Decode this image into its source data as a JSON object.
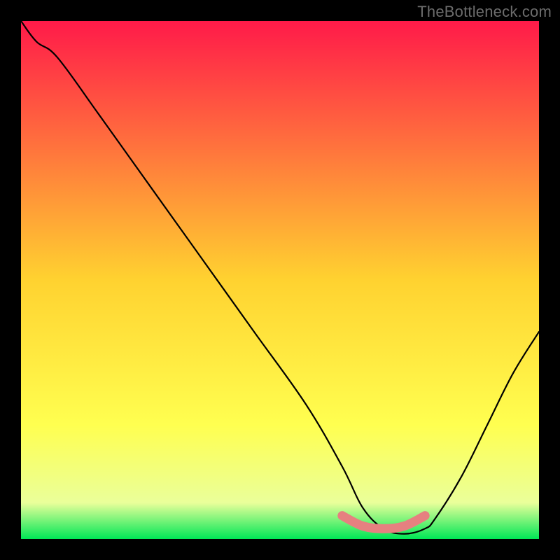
{
  "watermark": "TheBottleneck.com",
  "colors": {
    "gradient_top": "#ff1a49",
    "gradient_mid_upper": "#ff6a3e",
    "gradient_mid": "#ffd230",
    "gradient_mid_lower": "#ffff50",
    "gradient_lower": "#eaff9a",
    "gradient_bottom": "#00e756",
    "curve": "#000000",
    "bottom_arc": "#e68080",
    "frame_bg": "#000000"
  },
  "chart_data": {
    "type": "line",
    "title": "",
    "xlabel": "",
    "ylabel": "",
    "xlim": [
      0,
      100
    ],
    "ylim": [
      0,
      100
    ],
    "series": [
      {
        "name": "bottleneck-curve",
        "x": [
          0,
          3,
          7,
          15,
          25,
          35,
          45,
          55,
          62,
          66,
          70,
          74,
          78,
          80,
          85,
          90,
          95,
          100
        ],
        "y": [
          100,
          96,
          93,
          82,
          68,
          54,
          40,
          26,
          14,
          6,
          2,
          1,
          2,
          4,
          12,
          22,
          32,
          40
        ]
      },
      {
        "name": "optimal-band",
        "x": [
          62,
          66,
          70,
          74,
          78
        ],
        "y": [
          4.5,
          2.5,
          2.0,
          2.5,
          4.5
        ]
      }
    ],
    "annotations": []
  }
}
